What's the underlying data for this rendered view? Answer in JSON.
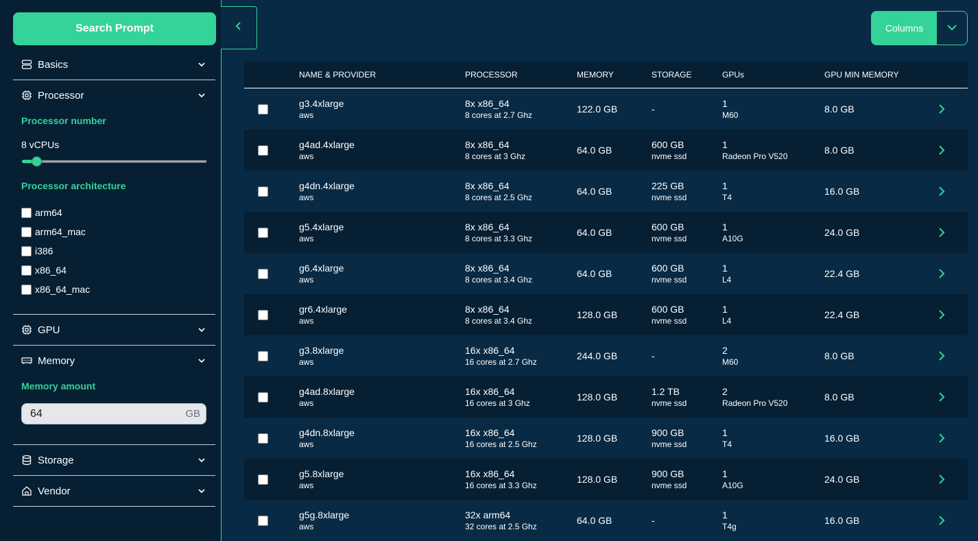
{
  "sidebar": {
    "search_button": "Search Prompt",
    "basics": "Basics",
    "processor": "Processor",
    "processor_number": "Processor number",
    "vcpus": "8 vCPUs",
    "vcpu_level": 0.05,
    "processor_architecture": "Processor architecture",
    "architectures": [
      "arm64",
      "arm64_mac",
      "i386",
      "x86_64",
      "x86_64_mac"
    ],
    "gpu": "GPU",
    "memory": "Memory",
    "memory_amount": "Memory amount",
    "memory_value": "64",
    "memory_unit": "GB",
    "storage": "Storage",
    "vendor": "Vendor"
  },
  "columns_button": "Columns",
  "table": {
    "headers": [
      "NAME & PROVIDER",
      "PROCESSOR",
      "MEMORY",
      "STORAGE",
      "GPUs",
      "GPU MIN MEMORY"
    ],
    "rows": [
      {
        "name": "g3.4xlarge",
        "provider": "aws",
        "proc": "8x x86_64",
        "proc_sub": "8 cores at 2.7 Ghz",
        "memory": "122.0 GB",
        "storage": "-",
        "storage_sub": "",
        "gpus": "1",
        "gpu_model": "M60",
        "gpu_mem": "8.0 GB"
      },
      {
        "name": "g4ad.4xlarge",
        "provider": "aws",
        "proc": "8x x86_64",
        "proc_sub": "8 cores at 3 Ghz",
        "memory": "64.0 GB",
        "storage": "600 GB",
        "storage_sub": "nvme ssd",
        "gpus": "1",
        "gpu_model": "Radeon Pro V520",
        "gpu_mem": "8.0 GB"
      },
      {
        "name": "g4dn.4xlarge",
        "provider": "aws",
        "proc": "8x x86_64",
        "proc_sub": "8 cores at 2.5 Ghz",
        "memory": "64.0 GB",
        "storage": "225 GB",
        "storage_sub": "nvme ssd",
        "gpus": "1",
        "gpu_model": "T4",
        "gpu_mem": "16.0 GB"
      },
      {
        "name": "g5.4xlarge",
        "provider": "aws",
        "proc": "8x x86_64",
        "proc_sub": "8 cores at 3.3 Ghz",
        "memory": "64.0 GB",
        "storage": "600 GB",
        "storage_sub": "nvme ssd",
        "gpus": "1",
        "gpu_model": "A10G",
        "gpu_mem": "24.0 GB"
      },
      {
        "name": "g6.4xlarge",
        "provider": "aws",
        "proc": "8x x86_64",
        "proc_sub": "8 cores at 3.4 Ghz",
        "memory": "64.0 GB",
        "storage": "600 GB",
        "storage_sub": "nvme ssd",
        "gpus": "1",
        "gpu_model": "L4",
        "gpu_mem": "22.4 GB"
      },
      {
        "name": "gr6.4xlarge",
        "provider": "aws",
        "proc": "8x x86_64",
        "proc_sub": "8 cores at 3.4 Ghz",
        "memory": "128.0 GB",
        "storage": "600 GB",
        "storage_sub": "nvme ssd",
        "gpus": "1",
        "gpu_model": "L4",
        "gpu_mem": "22.4 GB"
      },
      {
        "name": "g3.8xlarge",
        "provider": "aws",
        "proc": "16x x86_64",
        "proc_sub": "16 cores at 2.7 Ghz",
        "memory": "244.0 GB",
        "storage": "-",
        "storage_sub": "",
        "gpus": "2",
        "gpu_model": "M60",
        "gpu_mem": "8.0 GB"
      },
      {
        "name": "g4ad.8xlarge",
        "provider": "aws",
        "proc": "16x x86_64",
        "proc_sub": "16 cores at 3 Ghz",
        "memory": "128.0 GB",
        "storage": "1.2 TB",
        "storage_sub": "nvme ssd",
        "gpus": "2",
        "gpu_model": "Radeon Pro V520",
        "gpu_mem": "8.0 GB"
      },
      {
        "name": "g4dn.8xlarge",
        "provider": "aws",
        "proc": "16x x86_64",
        "proc_sub": "16 cores at 2.5 Ghz",
        "memory": "128.0 GB",
        "storage": "900 GB",
        "storage_sub": "nvme ssd",
        "gpus": "1",
        "gpu_model": "T4",
        "gpu_mem": "16.0 GB"
      },
      {
        "name": "g5.8xlarge",
        "provider": "aws",
        "proc": "16x x86_64",
        "proc_sub": "16 cores at 3.3 Ghz",
        "memory": "128.0 GB",
        "storage": "900 GB",
        "storage_sub": "nvme ssd",
        "gpus": "1",
        "gpu_model": "A10G",
        "gpu_mem": "24.0 GB"
      },
      {
        "name": "g5g.8xlarge",
        "provider": "aws",
        "proc": "32x arm64",
        "proc_sub": "32 cores at 2.5 Ghz",
        "memory": "64.0 GB",
        "storage": "-",
        "storage_sub": "",
        "gpus": "1",
        "gpu_model": "T4g",
        "gpu_mem": "16.0 GB"
      }
    ]
  },
  "colors": {
    "accent": "#34d399",
    "background": "#082a44",
    "panel": "#061f33"
  }
}
